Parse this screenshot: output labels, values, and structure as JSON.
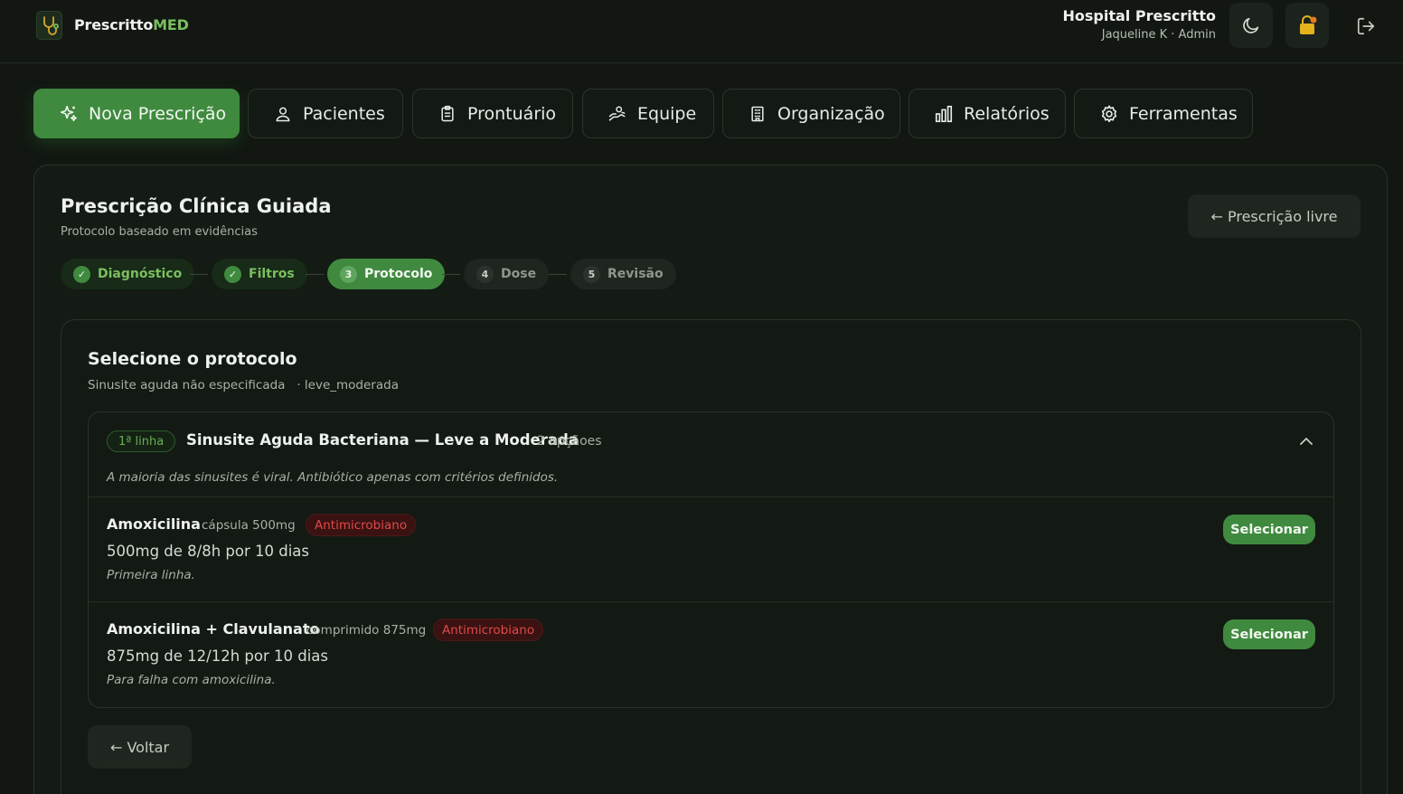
{
  "header": {
    "brand_main": "Prescritto",
    "brand_accent": "MED",
    "hospital": "Hospital Prescritto",
    "user": "Jaqueline K · Admin",
    "icons": [
      "moon-icon",
      "lock-icon",
      "logout-icon"
    ]
  },
  "nav": {
    "tabs": [
      {
        "label": "Nova Prescrição",
        "icon": "sparkle-icon",
        "active": true
      },
      {
        "label": "Pacientes",
        "icon": "user-icon"
      },
      {
        "label": "Prontuário",
        "icon": "clipboard-icon"
      },
      {
        "label": "Equipe",
        "icon": "team-icon"
      },
      {
        "label": "Organização",
        "icon": "building-icon"
      },
      {
        "label": "Relatórios",
        "icon": "chart-icon"
      },
      {
        "label": "Ferramentas",
        "icon": "gear-icon"
      }
    ]
  },
  "panel": {
    "title": "Prescrição Clínica Guiada",
    "subtitle": "Protocolo baseado em evidências",
    "free_button": "← Prescrição livre"
  },
  "stepper": {
    "steps": [
      {
        "marker": "✓",
        "label": "Diagnóstico",
        "state": "done"
      },
      {
        "marker": "✓",
        "label": "Filtros",
        "state": "done"
      },
      {
        "marker": "3",
        "label": "Protocolo",
        "state": "current"
      },
      {
        "marker": "4",
        "label": "Dose",
        "state": "todo"
      },
      {
        "marker": "5",
        "label": "Revisão",
        "state": "todo"
      }
    ]
  },
  "protocol": {
    "title": "Selecione o protocolo",
    "diagnosis": "Sinusite aguda não especificada",
    "severity": "· leve_moderada",
    "group": {
      "line_badge": "1ª linha",
      "title": "Sinusite Aguda Bacteriana — Leve a Moderada",
      "count": "2 opçãoes",
      "note": "A maioria das sinusites é viral. Antibiótico apenas com critérios definidos.",
      "options": [
        {
          "name": "Amoxicilina",
          "form": "cápsula 500mg",
          "tag": "Antimicrobiano",
          "dose": "500mg de 8/8h por 10 dias",
          "note": "Primeira linha.",
          "button": "Selecionar"
        },
        {
          "name": "Amoxicilina + Clavulanato",
          "form": "comprimido 875mg",
          "tag": "Antimicrobiano",
          "dose": "875mg de 12/12h por 10 dias",
          "note": "Para falha com amoxicilina.",
          "button": "Selecionar"
        }
      ]
    },
    "back_button": "← Voltar"
  },
  "colors": {
    "accent": "#3f8a3f",
    "brand_accent": "#7bbf5e",
    "danger": "#e04848",
    "background": "#121712"
  }
}
